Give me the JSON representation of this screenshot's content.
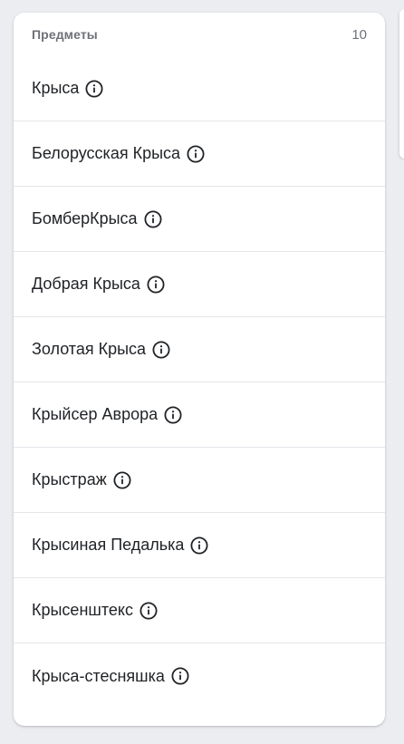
{
  "panel": {
    "title": "Предметы",
    "count": "10"
  },
  "items": [
    {
      "label": "Крыса",
      "icon": "info-icon"
    },
    {
      "label": "Белорусская Крыса",
      "icon": "info-icon"
    },
    {
      "label": "БомберКрыса",
      "icon": "info-icon"
    },
    {
      "label": "Добрая Крыса",
      "icon": "info-icon"
    },
    {
      "label": "Золотая Крыса",
      "icon": "info-icon"
    },
    {
      "label": "Крыйсер Аврора",
      "icon": "info-icon"
    },
    {
      "label": "Крыстраж",
      "icon": "info-icon"
    },
    {
      "label": "Крысиная Педалька",
      "icon": "info-icon"
    },
    {
      "label": "Крысенштекс",
      "icon": "info-icon"
    },
    {
      "label": "Крыса-стесняшка",
      "icon": "info-icon"
    }
  ],
  "colors": {
    "background": "#ebedf0",
    "card": "#ffffff",
    "text": "#1f2226",
    "muted": "#6d7178",
    "divider": "#e4e6ea"
  }
}
